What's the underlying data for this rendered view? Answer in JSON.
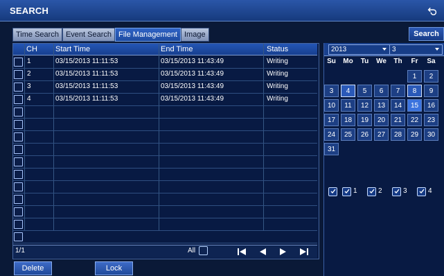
{
  "window": {
    "title": "SEARCH"
  },
  "tabs": [
    "Time Search",
    "Event Search",
    "File Management",
    "Image"
  ],
  "buttons": {
    "search": "Search",
    "delete": "Delete",
    "lock": "Lock"
  },
  "table": {
    "columns": [
      "CH",
      "Start Time",
      "End Time",
      "Status"
    ],
    "rows": [
      {
        "ch": "1",
        "start": "03/15/2013 11:11:53",
        "end": "03/15/2013 11:43:49",
        "status": "Writing"
      },
      {
        "ch": "2",
        "start": "03/15/2013 11:11:53",
        "end": "03/15/2013 11:43:49",
        "status": "Writing"
      },
      {
        "ch": "3",
        "start": "03/15/2013 11:11:53",
        "end": "03/15/2013 11:43:49",
        "status": "Writing"
      },
      {
        "ch": "4",
        "start": "03/15/2013 11:11:53",
        "end": "03/15/2013 11:43:49",
        "status": "Writing"
      }
    ]
  },
  "pagination": {
    "page": "1/1",
    "all_label": "All"
  },
  "calendar": {
    "year": "2013",
    "month": "3",
    "weekdays": [
      "Su",
      "Mo",
      "Tu",
      "We",
      "Th",
      "Fr",
      "Sa"
    ],
    "weeks": [
      [
        "",
        "",
        "",
        "",
        "",
        "1",
        "2"
      ],
      [
        "3",
        "4",
        "5",
        "6",
        "7",
        "8",
        "9"
      ],
      [
        "10",
        "11",
        "12",
        "13",
        "14",
        "15",
        "16"
      ],
      [
        "17",
        "18",
        "19",
        "20",
        "21",
        "22",
        "23"
      ],
      [
        "24",
        "25",
        "26",
        "27",
        "28",
        "29",
        "30"
      ],
      [
        "31",
        "",
        "",
        "",
        "",
        "",
        ""
      ]
    ]
  },
  "channels": [
    "1",
    "2",
    "3",
    "4"
  ]
}
